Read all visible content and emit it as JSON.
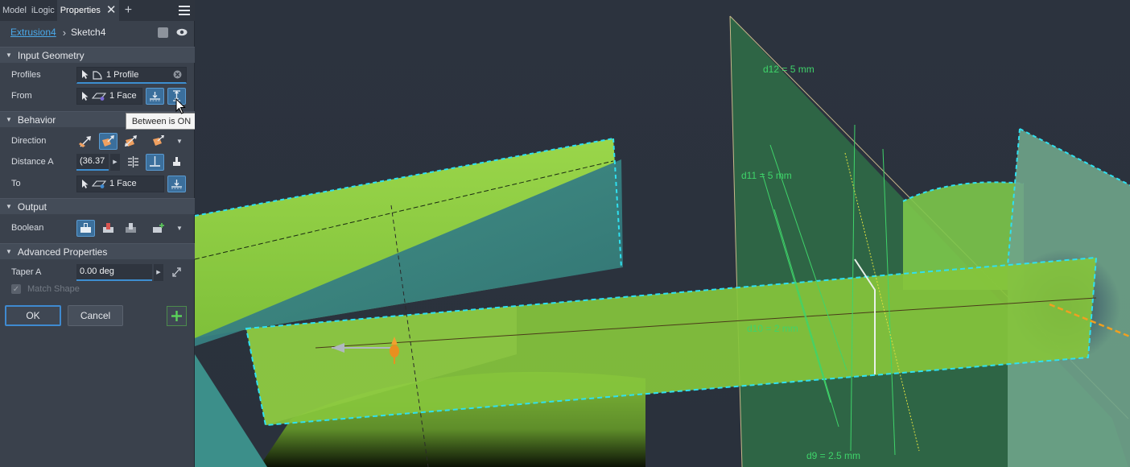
{
  "tabs": [
    {
      "label": "Model"
    },
    {
      "label": "iLogic"
    },
    {
      "label": "Properties",
      "active": true
    }
  ],
  "breadcrumb": {
    "parent": "Extrusion4",
    "current": "Sketch4"
  },
  "sections": {
    "input_geometry": "Input Geometry",
    "behavior": "Behavior",
    "output": "Output",
    "advanced": "Advanced Properties"
  },
  "fields": {
    "profiles": {
      "label": "Profiles",
      "value": "1 Profile"
    },
    "from": {
      "label": "From",
      "value": "1 Face"
    },
    "direction": {
      "label": "Direction"
    },
    "distance_a": {
      "label": "Distance A",
      "value": "(36.37"
    },
    "to": {
      "label": "To",
      "value": "1 Face"
    },
    "boolean": {
      "label": "Boolean"
    },
    "taper_a": {
      "label": "Taper A",
      "value": "0.00 deg"
    },
    "match_shape": {
      "label": "Match Shape",
      "checked": true,
      "enabled": false
    }
  },
  "tooltip": "Between is ON",
  "buttons": {
    "ok": "OK",
    "cancel": "Cancel"
  },
  "dimensions": {
    "d12": "d12 = 5 mm",
    "d11": "d11 = 5 mm",
    "d10": "d10 = 2 mm",
    "d9": "d9 = 2.5 mm"
  },
  "colors": {
    "accent": "#3d8ed0",
    "link": "#4aa8e8",
    "solid_green": "#8fd13f",
    "dimension_green": "#3fd46a",
    "selection_cyan": "#2fe0f0"
  }
}
